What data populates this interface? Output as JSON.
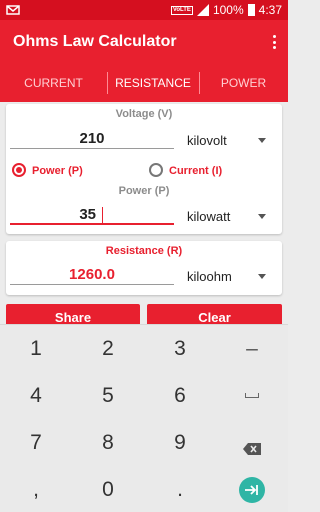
{
  "status": {
    "volte": "VoLTE",
    "battery": "100%",
    "time": "4:37"
  },
  "app": {
    "title": "Ohms Law Calculator"
  },
  "tabs": [
    {
      "label": "CURRENT",
      "active": false
    },
    {
      "label": "RESISTANCE",
      "active": true
    },
    {
      "label": "POWER",
      "active": false
    }
  ],
  "voltage": {
    "label": "Voltage (V)",
    "value": "210",
    "unit": "kilovolt"
  },
  "mode": {
    "power_label": "Power (P)",
    "current_label": "Current (I)",
    "selected": "power"
  },
  "power": {
    "label": "Power (P)",
    "value": "35",
    "unit": "kilowatt"
  },
  "resistance": {
    "label": "Resistance (R)",
    "value": "1260.0",
    "unit": "kiloohm"
  },
  "buttons": {
    "share": "Share",
    "clear": "Clear"
  },
  "keyboard": {
    "rows": [
      [
        "1",
        "2",
        "3",
        "–"
      ],
      [
        "4",
        "5",
        "6",
        "space"
      ],
      [
        "7",
        "8",
        "9",
        "backspace"
      ],
      [
        ",",
        "0",
        ".",
        "go"
      ]
    ],
    "go_color": "#2fb5a5"
  },
  "colors": {
    "primary": "#e8202f",
    "status_bar": "#d50f1f"
  }
}
